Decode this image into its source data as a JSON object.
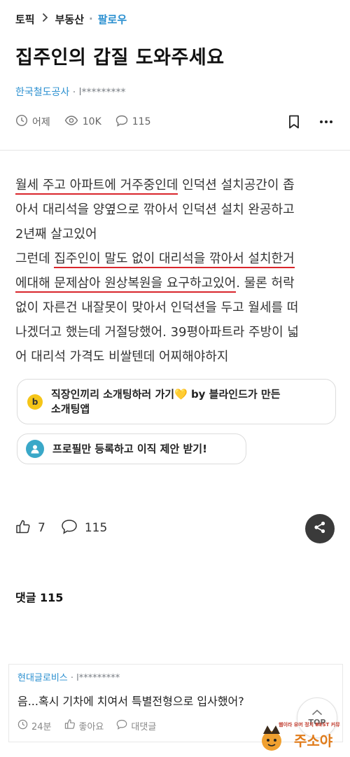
{
  "breadcrumb": {
    "topic": "토픽",
    "category": "부동산",
    "follow": "팔로우"
  },
  "post": {
    "title": "집주인의 갑질 도와주세요",
    "author_company": "한국철도공사",
    "author_sep": " · ",
    "author_name": "l*********",
    "time": "어제",
    "views": "10K",
    "comments": "115",
    "body": {
      "l1a": "월세 주고 아파트에 거주중인데",
      "l1b": " 인덕션 설치공간이 좁",
      "l2": "아서 대리석을 양옆으로 깎아서 인덕션 설치 완공하고",
      "l3": "2년째 살고있어",
      "l4a": "그런데 ",
      "l4b": "집주인이 말도 없이 대리석을 깎아서 설치한거",
      "l5a": "에대해 문제삼아 원상복원을 요구하고있어",
      "l5b": ". 물론 허락",
      "l6": "없이 자른건 내잘못이 맞아서 인덕션을 두고 월세를 떠",
      "l7": "나겠더고 했는데 거절당했어. 39평아파트라 주방이 넓",
      "l8": "어 대리석 가격도 비쌀텐데 어찌해야하지"
    }
  },
  "banners": {
    "blind_icon": "b",
    "blind_text_1": "직장인끼리 소개팅하러 가기💛 by 블라인드가 만든",
    "blind_text_2": "소개팅앱",
    "profile_text": "프로필만 등록하고 이직 제안 받기!"
  },
  "reactions": {
    "likes": "7",
    "comments": "115"
  },
  "comments_section": {
    "title": "댓글 115"
  },
  "comment1": {
    "company": "현대글로비스",
    "sep": " · ",
    "name": "l*********",
    "text": "음...혹시 기차에 치여서 특별전형으로 입사했어?",
    "time": "24분",
    "like_label": "좋아요",
    "reply_label": "대댓글"
  },
  "top_button": {
    "label": "TOP"
  },
  "watermark": {
    "line1": "웹이라 유머 정치 BEST 커뮤",
    "line2": "주소야"
  },
  "icons": [
    "chevron-right-icon",
    "clock-icon",
    "eye-icon",
    "comment-icon",
    "bookmark-icon",
    "more-icon",
    "thumbs-up-icon",
    "share-icon",
    "profile-icon",
    "chevron-up-icon"
  ],
  "colors": {
    "accent_blue": "#2a8fd0",
    "underline_red": "#d9262c",
    "share_bg": "#3a3a3a",
    "blind_yellow": "#f5c518",
    "profile_teal": "#3aa8c8"
  }
}
